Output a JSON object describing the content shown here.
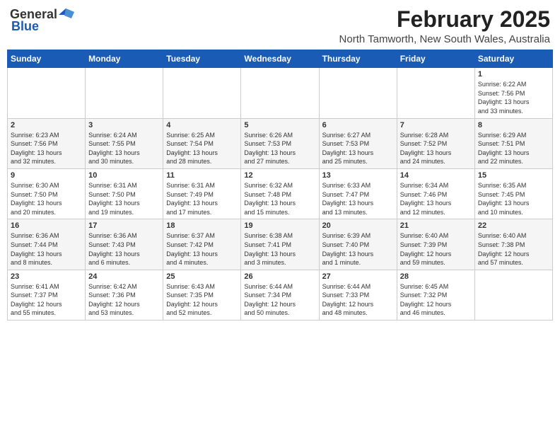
{
  "header": {
    "logo_general": "General",
    "logo_blue": "Blue",
    "month_title": "February 2025",
    "location": "North Tamworth, New South Wales, Australia"
  },
  "weekdays": [
    "Sunday",
    "Monday",
    "Tuesday",
    "Wednesday",
    "Thursday",
    "Friday",
    "Saturday"
  ],
  "weeks": [
    [
      {
        "day": "",
        "info": ""
      },
      {
        "day": "",
        "info": ""
      },
      {
        "day": "",
        "info": ""
      },
      {
        "day": "",
        "info": ""
      },
      {
        "day": "",
        "info": ""
      },
      {
        "day": "",
        "info": ""
      },
      {
        "day": "1",
        "info": "Sunrise: 6:22 AM\nSunset: 7:56 PM\nDaylight: 13 hours\nand 33 minutes."
      }
    ],
    [
      {
        "day": "2",
        "info": "Sunrise: 6:23 AM\nSunset: 7:56 PM\nDaylight: 13 hours\nand 32 minutes."
      },
      {
        "day": "3",
        "info": "Sunrise: 6:24 AM\nSunset: 7:55 PM\nDaylight: 13 hours\nand 30 minutes."
      },
      {
        "day": "4",
        "info": "Sunrise: 6:25 AM\nSunset: 7:54 PM\nDaylight: 13 hours\nand 28 minutes."
      },
      {
        "day": "5",
        "info": "Sunrise: 6:26 AM\nSunset: 7:53 PM\nDaylight: 13 hours\nand 27 minutes."
      },
      {
        "day": "6",
        "info": "Sunrise: 6:27 AM\nSunset: 7:53 PM\nDaylight: 13 hours\nand 25 minutes."
      },
      {
        "day": "7",
        "info": "Sunrise: 6:28 AM\nSunset: 7:52 PM\nDaylight: 13 hours\nand 24 minutes."
      },
      {
        "day": "8",
        "info": "Sunrise: 6:29 AM\nSunset: 7:51 PM\nDaylight: 13 hours\nand 22 minutes."
      }
    ],
    [
      {
        "day": "9",
        "info": "Sunrise: 6:30 AM\nSunset: 7:50 PM\nDaylight: 13 hours\nand 20 minutes."
      },
      {
        "day": "10",
        "info": "Sunrise: 6:31 AM\nSunset: 7:50 PM\nDaylight: 13 hours\nand 19 minutes."
      },
      {
        "day": "11",
        "info": "Sunrise: 6:31 AM\nSunset: 7:49 PM\nDaylight: 13 hours\nand 17 minutes."
      },
      {
        "day": "12",
        "info": "Sunrise: 6:32 AM\nSunset: 7:48 PM\nDaylight: 13 hours\nand 15 minutes."
      },
      {
        "day": "13",
        "info": "Sunrise: 6:33 AM\nSunset: 7:47 PM\nDaylight: 13 hours\nand 13 minutes."
      },
      {
        "day": "14",
        "info": "Sunrise: 6:34 AM\nSunset: 7:46 PM\nDaylight: 13 hours\nand 12 minutes."
      },
      {
        "day": "15",
        "info": "Sunrise: 6:35 AM\nSunset: 7:45 PM\nDaylight: 13 hours\nand 10 minutes."
      }
    ],
    [
      {
        "day": "16",
        "info": "Sunrise: 6:36 AM\nSunset: 7:44 PM\nDaylight: 13 hours\nand 8 minutes."
      },
      {
        "day": "17",
        "info": "Sunrise: 6:36 AM\nSunset: 7:43 PM\nDaylight: 13 hours\nand 6 minutes."
      },
      {
        "day": "18",
        "info": "Sunrise: 6:37 AM\nSunset: 7:42 PM\nDaylight: 13 hours\nand 4 minutes."
      },
      {
        "day": "19",
        "info": "Sunrise: 6:38 AM\nSunset: 7:41 PM\nDaylight: 13 hours\nand 3 minutes."
      },
      {
        "day": "20",
        "info": "Sunrise: 6:39 AM\nSunset: 7:40 PM\nDaylight: 13 hours\nand 1 minute."
      },
      {
        "day": "21",
        "info": "Sunrise: 6:40 AM\nSunset: 7:39 PM\nDaylight: 12 hours\nand 59 minutes."
      },
      {
        "day": "22",
        "info": "Sunrise: 6:40 AM\nSunset: 7:38 PM\nDaylight: 12 hours\nand 57 minutes."
      }
    ],
    [
      {
        "day": "23",
        "info": "Sunrise: 6:41 AM\nSunset: 7:37 PM\nDaylight: 12 hours\nand 55 minutes."
      },
      {
        "day": "24",
        "info": "Sunrise: 6:42 AM\nSunset: 7:36 PM\nDaylight: 12 hours\nand 53 minutes."
      },
      {
        "day": "25",
        "info": "Sunrise: 6:43 AM\nSunset: 7:35 PM\nDaylight: 12 hours\nand 52 minutes."
      },
      {
        "day": "26",
        "info": "Sunrise: 6:44 AM\nSunset: 7:34 PM\nDaylight: 12 hours\nand 50 minutes."
      },
      {
        "day": "27",
        "info": "Sunrise: 6:44 AM\nSunset: 7:33 PM\nDaylight: 12 hours\nand 48 minutes."
      },
      {
        "day": "28",
        "info": "Sunrise: 6:45 AM\nSunset: 7:32 PM\nDaylight: 12 hours\nand 46 minutes."
      },
      {
        "day": "",
        "info": ""
      }
    ]
  ]
}
